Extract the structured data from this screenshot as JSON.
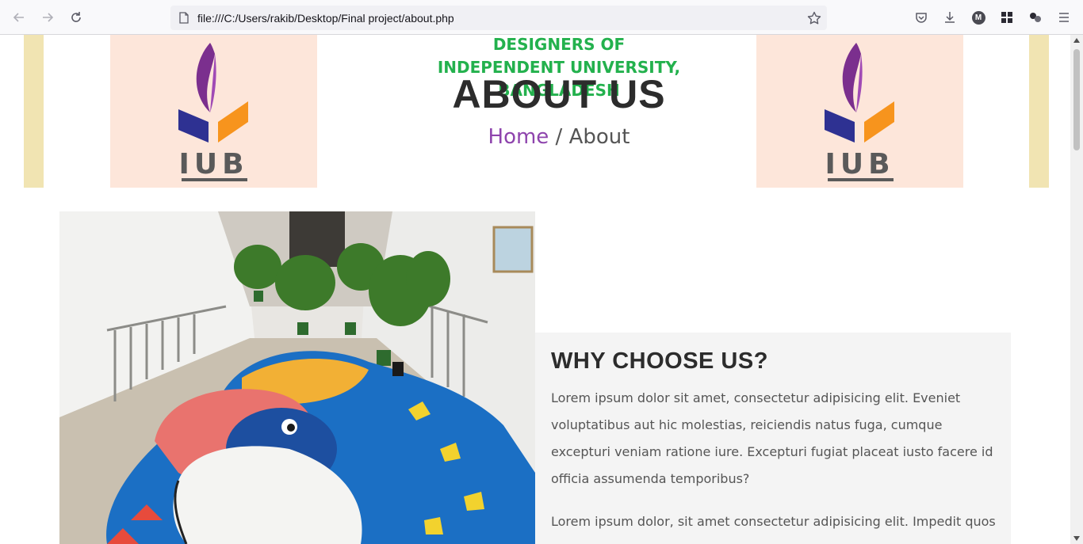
{
  "browser": {
    "url": "file:///C:/Users/rakib/Desktop/Final project/about.php",
    "icons": [
      "back-icon",
      "forward-icon",
      "reload-icon",
      "page-icon",
      "bookmark-star-icon",
      "pocket-icon",
      "download-icon",
      "account-icon",
      "extensions-icon",
      "containers-icon",
      "menu-icon"
    ],
    "account_letter": "M"
  },
  "hero": {
    "subtitle_line1": "DESIGNERS OF",
    "subtitle_line2": "INDEPENDENT UNIVERSITY, BANGLADESH",
    "title": "ABOUT US",
    "breadcrumb_home": "Home",
    "breadcrumb_separator": " / ",
    "breadcrumb_current": "About",
    "logo_text": "IUB",
    "colors": {
      "band": "#f1e4b2",
      "logo_bg": "#fde6da",
      "subtitle": "#23b14d",
      "link": "#8e44ad"
    }
  },
  "why": {
    "title": "WHY CHOOSE US?",
    "paragraph1": "Lorem ipsum dolor sit amet, consectetur adipisicing elit. Eveniet voluptatibus aut hic molestias, reiciendis natus fuga, cumque excepturi veniam ratione iure. Excepturi fugiat placeat iusto facere id officia assumenda temporibus?",
    "paragraph2": "Lorem ipsum dolor, sit amet consectetur adipisicing elit. Impedit quos"
  }
}
